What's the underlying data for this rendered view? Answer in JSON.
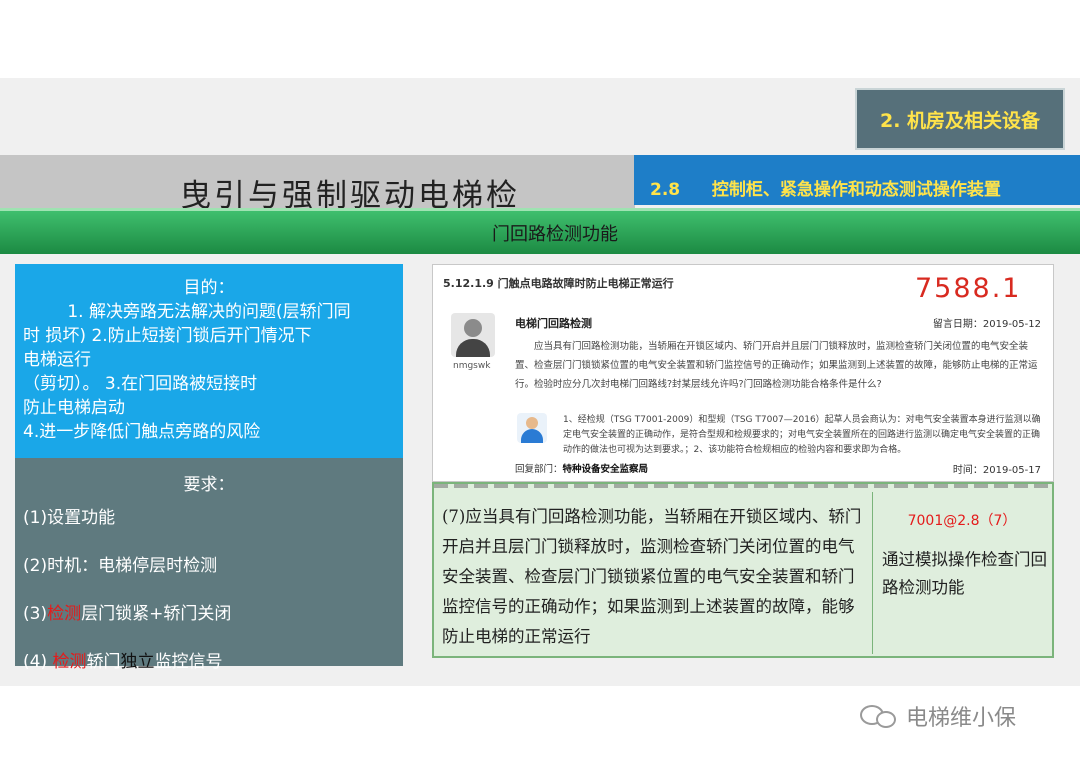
{
  "slide": {
    "section": "2. 机房及相关设备",
    "title": "曳引与强制驱动电梯检",
    "subsection": {
      "number": "2.8",
      "title": "控制柜、紧急操作和动态测试操作装置"
    },
    "band": "门回路检测功能"
  },
  "purpose": {
    "heading": "目的：",
    "l1": "1. 解决旁路无法解决的问题(层轿门同",
    "l2": "时 损坏) 2.防止短接门锁后开门情况下",
    "l3": "电梯运行",
    "l4": "（剪切）。 3.在门回路被短接时",
    "l5": "防止电梯启动",
    "l6": "4.进一步降低门触点旁路的风险"
  },
  "requirements": {
    "heading": "要求：",
    "r1": "(1)设置功能",
    "r2": "(2)时机：电梯停层时检测",
    "r3_prefix": "(3)",
    "r3_red": "检测",
    "r3_rest": "层门锁紧+轿门关闭",
    "r4_prefix": "(4) ",
    "r4_red": "检测",
    "r4_mid": "轿门",
    "r4_black": "独立",
    "r4_rest": "监控信号"
  },
  "doc": {
    "clause": "5.12.1.9   门触点电路故障时防止电梯正常运行",
    "big_number": "7588.1",
    "user": "nmgswk",
    "question_title": "电梯门回路检测",
    "question_date": "留言日期：2019-05-12",
    "question_text": "应当具有门回路检测功能，当轿厢在开锁区域内、轿门开启并且层门门锁释放时，监测检查轿门关闭位置的电气安全装置、检查层门门锁锁紧位置的电气安全装置和轿门监控信号的正确动作；如果监测到上述装置的故障，能够防止电梯的正常运行。检验时应分几次封电梯门回路线?封某层线允许吗?门回路检测功能合格条件是什么?",
    "answer_text": "1、经检规（TSG T7001-2009）和型规（TSG T7007—2016）起草人员会商认为：对电气安全装置本身进行监测以确定电气安全装置的正确动作，是符合型规和检规要求的；对电气安全装置所在的回路进行监测以确定电气安全装置的正确动作的做法也可视为达到要求。；2、该功能符合检规相应的检验内容和要求即为合格。",
    "dept_label": "回复部门：",
    "dept_name": "特种设备安全监察局",
    "reply_date": "时间：2019-05-17"
  },
  "regulation": {
    "text": "(7)应当具有门回路检测功能，当轿厢在开锁区域内、轿门开启并且层门门锁释放时，监测检查轿门关闭位置的电气安全装置、检查层门门锁锁紧位置的电气安全装置和轿门监控信号的正确动作；如果监测到上述装置的故障，能够防止电梯的正常运行",
    "code": "7001@2.8（7）",
    "method": "通过模拟操作检查门回路检测功能"
  },
  "watermark": {
    "text": "电梯维小保",
    "icon": "wechat-icon"
  }
}
